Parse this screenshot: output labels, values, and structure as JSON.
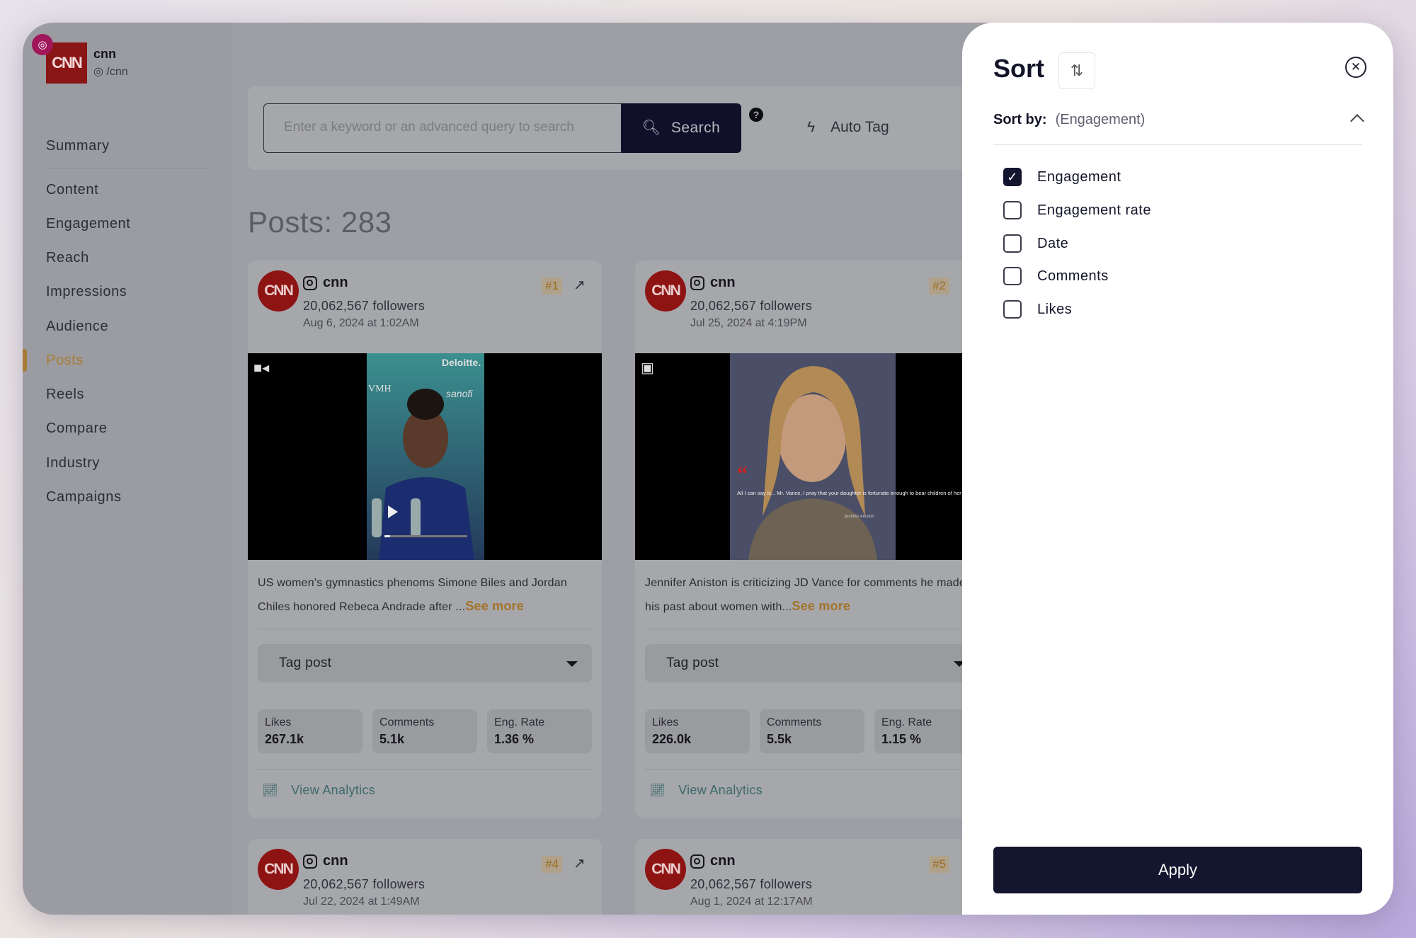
{
  "brand": {
    "name": "cnn",
    "handle": "/cnn",
    "logo_text": "CNN"
  },
  "nav": [
    {
      "label": "Summary"
    },
    {
      "label": "Content"
    },
    {
      "label": "Engagement"
    },
    {
      "label": "Reach"
    },
    {
      "label": "Impressions"
    },
    {
      "label": "Audience"
    },
    {
      "label": "Posts",
      "active": true
    },
    {
      "label": "Reels"
    },
    {
      "label": "Compare"
    },
    {
      "label": "Industry"
    },
    {
      "label": "Campaigns"
    }
  ],
  "search": {
    "placeholder": "Enter a keyword or an advanced query to search",
    "button_label": "Search",
    "help": "?",
    "autotag_label": "Auto Tag"
  },
  "posts_title": "Posts: 283",
  "cards": [
    {
      "account": "cnn",
      "followers": "20,062,567 followers",
      "date": "Aug 6, 2024 at 1:02AM",
      "rank": "#1",
      "caption": "US women's gymnastics phenoms Simone Biles and Jordan Chiles honored Rebeca Andrade after ...",
      "see_more": "See more",
      "tag_label": "Tag post",
      "likes_label": "Likes",
      "likes": "267.1k",
      "comments_label": "Comments",
      "comments": "5.1k",
      "eng_label": "Eng. Rate",
      "eng": "1.36 %",
      "analytics": "View Analytics",
      "media_type": "video"
    },
    {
      "account": "cnn",
      "followers": "20,062,567 followers",
      "date": "Jul 25, 2024 at 4:19PM",
      "rank": "#2",
      "caption": "Jennifer Aniston is criticizing JD Vance for comments he made in his past about women with...",
      "see_more": "See more",
      "tag_label": "Tag post",
      "likes_label": "Likes",
      "likes": "226.0k",
      "comments_label": "Comments",
      "comments": "5.5k",
      "eng_label": "Eng. Rate",
      "eng": "1.15 %",
      "analytics": "View Analytics",
      "media_type": "image"
    },
    {
      "account": "cnn",
      "followers": "20,062,567 followers",
      "date": "Jul 22, 2024 at 1:49AM",
      "rank": "#4"
    },
    {
      "account": "cnn",
      "followers": "20,062,567 followers",
      "date": "Aug 1, 2024 at 12:17AM",
      "rank": "#5"
    }
  ],
  "sort_panel": {
    "title": "Sort",
    "sort_by_label": "Sort by:",
    "sort_by_value": "(Engagement)",
    "options": [
      {
        "label": "Engagement",
        "checked": true
      },
      {
        "label": "Engagement rate",
        "checked": false
      },
      {
        "label": "Date",
        "checked": false
      },
      {
        "label": "Comments",
        "checked": false
      },
      {
        "label": "Likes",
        "checked": false
      }
    ],
    "apply_label": "Apply"
  },
  "media_overlay": {
    "sponsor_1": "Deloitte.",
    "sponsor_2": "sanofi",
    "sponsor_3": "VMH",
    "quote": "All I can say is... Mr. Vance, I pray that your daughter is fortunate enough to bear children of her own one day.",
    "quote_attr": "Jennifer Aniston"
  },
  "colors": {
    "accent": "#a87c34",
    "navy": "#14152e",
    "cnn_red": "#8e1414",
    "link": "#3d6a6a"
  }
}
